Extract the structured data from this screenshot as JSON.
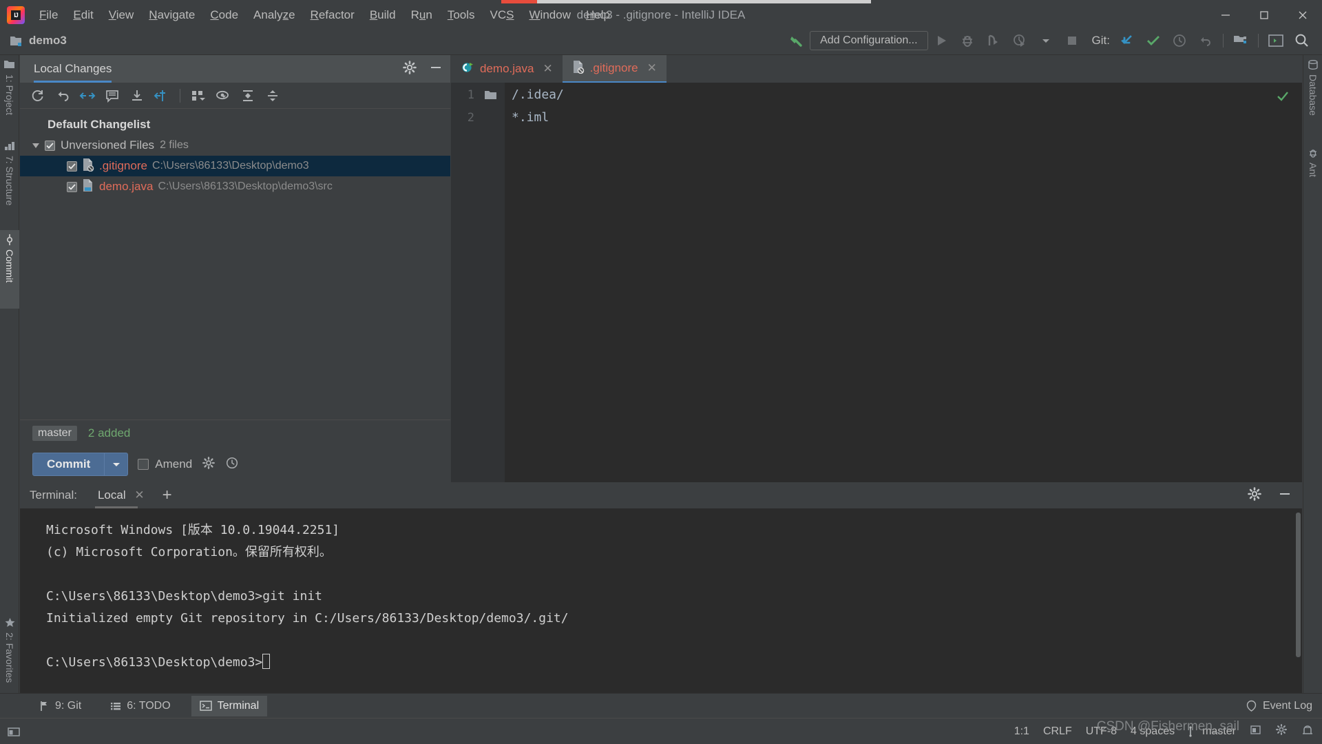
{
  "window": {
    "title": "demo3 - .gitignore - IntelliJ IDEA",
    "minimize": "—",
    "maximize": "❐",
    "close": "✕"
  },
  "menu": {
    "items": [
      {
        "label": "File",
        "mnemonic": "F"
      },
      {
        "label": "Edit",
        "mnemonic": "E"
      },
      {
        "label": "View",
        "mnemonic": "V"
      },
      {
        "label": "Navigate",
        "mnemonic": "N"
      },
      {
        "label": "Code",
        "mnemonic": "C"
      },
      {
        "label": "Analyze",
        "mnemonic": "z"
      },
      {
        "label": "Refactor",
        "mnemonic": "R"
      },
      {
        "label": "Build",
        "mnemonic": "B"
      },
      {
        "label": "Run",
        "mnemonic": "u"
      },
      {
        "label": "Tools",
        "mnemonic": "T"
      },
      {
        "label": "VCS",
        "mnemonic": "S"
      },
      {
        "label": "Window",
        "mnemonic": "W"
      },
      {
        "label": "Help",
        "mnemonic": "H"
      }
    ]
  },
  "toolbar": {
    "project_name": "demo3",
    "add_configuration": "Add Configuration...",
    "git_label": "Git:",
    "icons": [
      "build-hammer-icon",
      "run-icon",
      "debug-icon",
      "run-coverage-icon",
      "profiler-icon",
      "dropdown-icon",
      "stop-icon",
      "git-update-icon",
      "git-commit-icon",
      "git-history-icon",
      "git-rollback-icon",
      "project-structure-icon",
      "terminal-icon",
      "search-everywhere-icon"
    ]
  },
  "left_strip": {
    "items": [
      {
        "label": "1: Project",
        "mnemonic": "1",
        "icon": "project-folder-icon",
        "selected": false
      },
      {
        "label": "7: Structure",
        "mnemonic": "7",
        "icon": "structure-icon",
        "selected": false
      },
      {
        "label": "Commit",
        "mnemonic": "",
        "icon": "commit-icon",
        "selected": true
      },
      {
        "label": "2: Favorites",
        "mnemonic": "2",
        "icon": "star-icon",
        "selected": false
      }
    ]
  },
  "right_strip": {
    "items": [
      {
        "label": "Database",
        "icon": "database-icon"
      },
      {
        "label": "Ant",
        "icon": "ant-icon"
      }
    ]
  },
  "local_changes": {
    "tab_label": "Local Changes",
    "head_icons": [
      "gear-icon",
      "minimize-icon"
    ],
    "toolbar_icons": [
      "refresh-icon",
      "rollback-icon",
      "revert-icon",
      "comment-icon",
      "download-icon",
      "move-to-changelist-icon",
      "group-by-icon",
      "preview-eye-icon",
      "expand-all-icon",
      "collapse-all-icon"
    ],
    "changelist_title": "Default Changelist",
    "group": {
      "label": "Unversioned Files",
      "count": "2 files",
      "expanded": true,
      "checked": true
    },
    "files": [
      {
        "name": ".gitignore",
        "path": "C:\\Users\\86133\\Desktop\\demo3",
        "icon": "gitignore-file-icon",
        "checked": true,
        "selected": true
      },
      {
        "name": "demo.java",
        "path": "C:\\Users\\86133\\Desktop\\demo3\\src",
        "icon": "java-file-icon",
        "checked": true,
        "selected": false
      }
    ],
    "branch": "master",
    "added_summary": "2 added",
    "commit_button": "Commit",
    "amend_label": "Amend",
    "amend_checked": false,
    "bottom_icons": [
      "gear-icon",
      "history-clock-icon"
    ]
  },
  "editor": {
    "tabs": [
      {
        "label": "demo.java",
        "icon": "java-class-run-icon",
        "active": false,
        "close": "✕"
      },
      {
        "label": ".gitignore",
        "icon": "gitignore-file-icon",
        "active": true,
        "close": "✕"
      }
    ],
    "lines": [
      {
        "number": "1",
        "text": "/.idea/",
        "gutter_icon": "folder-icon"
      },
      {
        "number": "2",
        "text": "*.iml",
        "gutter_icon": ""
      }
    ],
    "inspection_status": "ok-checkmark-icon"
  },
  "terminal": {
    "label": "Terminal:",
    "tab": "Local",
    "tab_close": "✕",
    "add_tab": "+",
    "head_icons": [
      "gear-icon",
      "minimize-icon"
    ],
    "lines": [
      "Microsoft Windows [版本 10.0.19044.2251]",
      "(c) Microsoft Corporation。保留所有权利。",
      "",
      "C:\\Users\\86133\\Desktop\\demo3>git init",
      "Initialized empty Git repository in C:/Users/86133/Desktop/demo3/.git/",
      "",
      "C:\\Users\\86133\\Desktop\\demo3>"
    ]
  },
  "bottom_tabs": {
    "items": [
      {
        "label": "9: Git",
        "mnemonic": "9",
        "icon": "git-branch-icon",
        "selected": false
      },
      {
        "label": "6: TODO",
        "mnemonic": "6",
        "icon": "todo-list-icon",
        "selected": false
      },
      {
        "label": "Terminal",
        "mnemonic": "",
        "icon": "terminal-icon",
        "selected": true
      }
    ],
    "event_log": "Event Log",
    "event_log_icon": "balloon-icon"
  },
  "status_bar": {
    "caret": "1:1",
    "line_separator": "CRLF",
    "encoding": "UTF-8",
    "indent": "4 spaces",
    "branch": "master",
    "branch_icon": "git-branch-icon",
    "right_icons": [
      "memory-indicator-icon",
      "settings-gear-icon",
      "hector-icon"
    ]
  },
  "watermark": "CSDN @Fishermen_sail",
  "colors": {
    "accent_blue": "#4a88c7",
    "panel_bg": "#3c3f41",
    "editor_bg": "#2b2b2b",
    "selected_row": "#0d293e",
    "file_red": "#e06c5a",
    "added_green": "#6fa86f",
    "progress_red": "#e74c3c"
  }
}
